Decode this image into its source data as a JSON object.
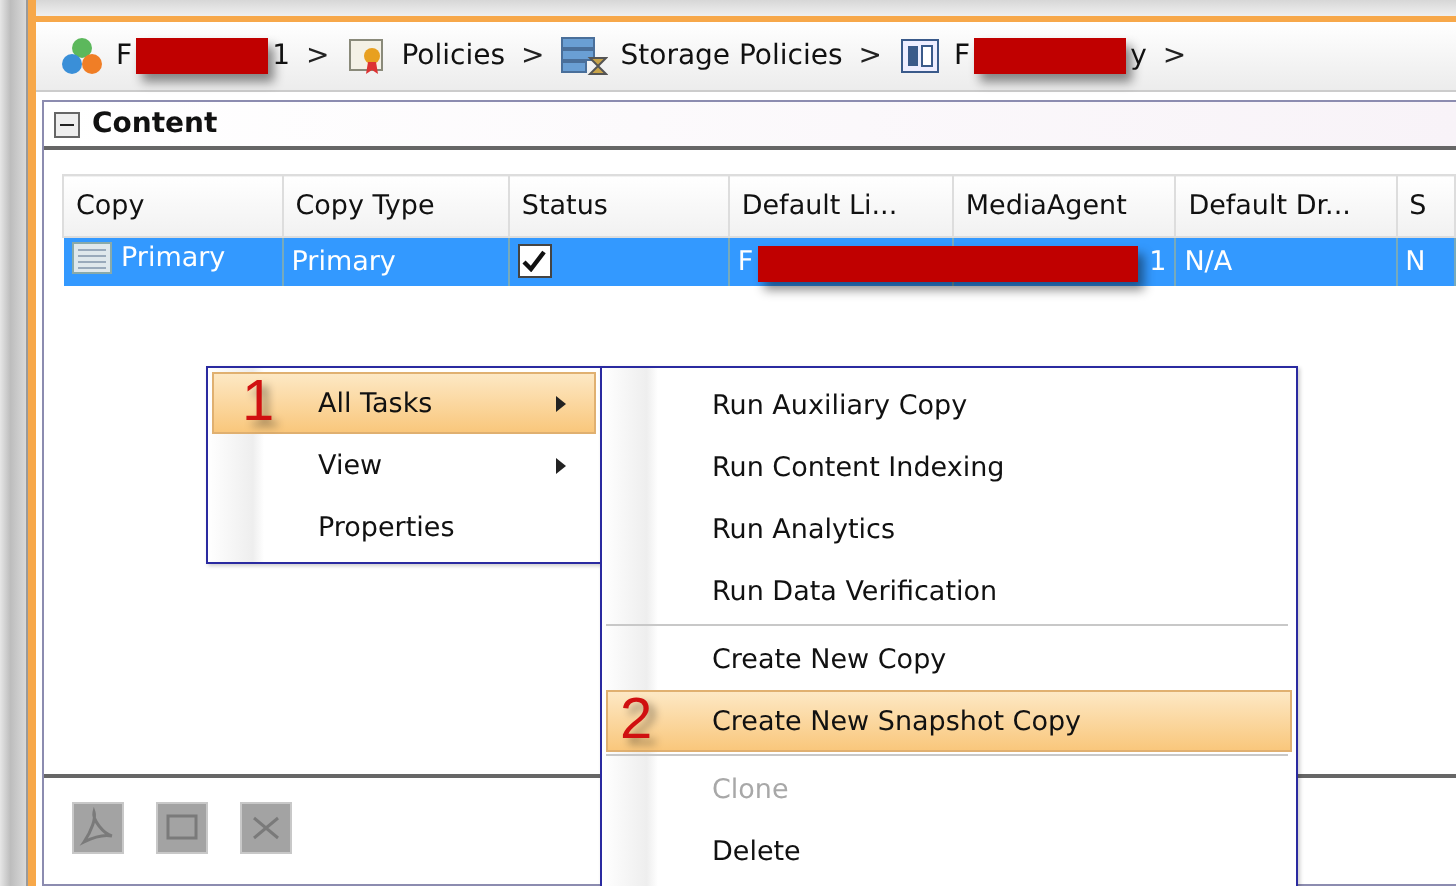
{
  "breadcrumb": [
    {
      "kind": "cluster",
      "label": "F",
      "label_end": "1",
      "redacted": true,
      "separator": ">"
    },
    {
      "kind": "policy",
      "label": "Policies",
      "separator": ">"
    },
    {
      "kind": "storage",
      "label": "Storage Policies",
      "separator": ">"
    },
    {
      "kind": "document",
      "label": "F",
      "label_end": "y",
      "redacted": true,
      "separator": ">"
    }
  ],
  "panel": {
    "title": "Content",
    "expanded": true
  },
  "table": {
    "columns": [
      "Copy",
      "Copy Type",
      "Status",
      "Default Li...",
      "MediaAgent",
      "Default Dr...",
      "S"
    ],
    "rows": [
      {
        "selected": true,
        "copy": "Primary",
        "copy_type": "Primary",
        "status_checked": true,
        "default_library": "F",
        "media_agent": "1",
        "redacted": true,
        "default_drive": "N/A",
        "column_7": "N"
      }
    ]
  },
  "context_menu": [
    {
      "label": "All Tasks",
      "has_submenu": true,
      "selected": true,
      "annotation": "1"
    },
    {
      "label": "View",
      "has_submenu": true,
      "selected": false
    },
    {
      "label": "Properties",
      "has_submenu": false,
      "selected": false
    }
  ],
  "submenu": [
    {
      "label": "Run Auxiliary Copy",
      "selected": false,
      "disabled": false,
      "separator_before": false
    },
    {
      "label": "Run Content Indexing",
      "selected": false,
      "disabled": false,
      "separator_before": false
    },
    {
      "label": "Run Analytics",
      "selected": false,
      "disabled": false,
      "separator_before": false
    },
    {
      "label": "Run Data Verification",
      "selected": false,
      "disabled": false,
      "separator_before": false
    },
    {
      "label": "Create New Copy",
      "selected": false,
      "disabled": false,
      "separator_before": true
    },
    {
      "label": "Create New Snapshot Copy",
      "selected": true,
      "disabled": false,
      "separator_before": false,
      "annotation": "2"
    },
    {
      "label": "Clone",
      "selected": false,
      "disabled": true,
      "separator_before": true
    },
    {
      "label": "Delete",
      "selected": false,
      "disabled": false,
      "separator_before": false
    }
  ],
  "bottom_toolbar": [
    {
      "kind": "pdf"
    },
    {
      "kind": "image"
    },
    {
      "kind": "sheet"
    }
  ]
}
